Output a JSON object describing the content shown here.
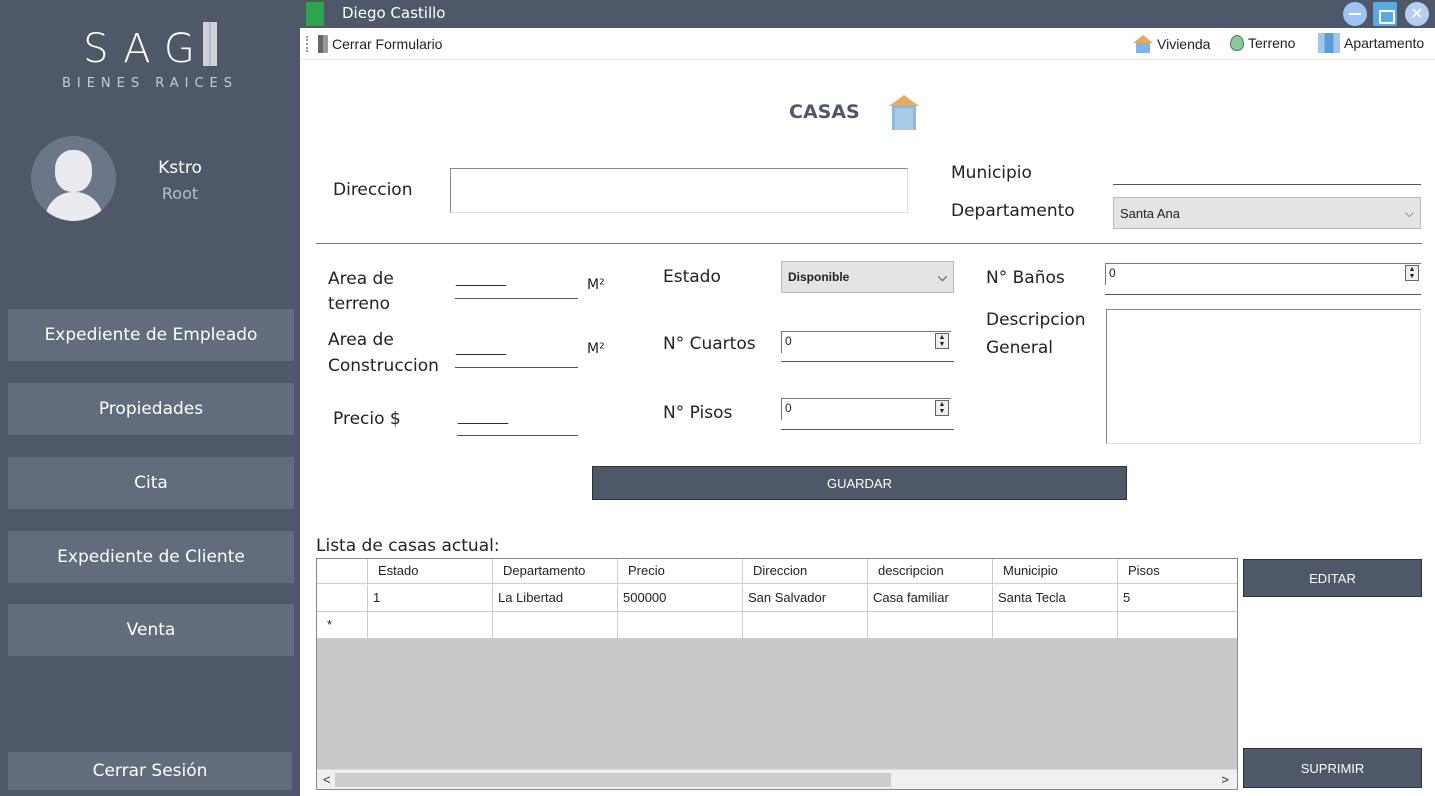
{
  "sidebar": {
    "logo": "SAG",
    "logo_sub": "BIENES RAICES",
    "user_name": "Kstro",
    "user_role": "Root",
    "nav": [
      "Expediente de Empleado",
      "Propiedades",
      "Cita",
      "Expediente de Cliente",
      "Venta"
    ],
    "logout": "Cerrar Sesión"
  },
  "titlebar": {
    "title": "Diego Castillo",
    "close_glyph": "✕"
  },
  "toolbar": {
    "close_form": "Cerrar Formulario",
    "vivienda": "Vivienda",
    "terreno": "Terreno",
    "apartamento": "Apartamento"
  },
  "form": {
    "heading": "CASAS",
    "direccion_label": "Direccion",
    "direccion_value": "",
    "municipio_label": "Municipio",
    "departamento_label": "Departamento",
    "departamento_value": "Santa Ana",
    "area_terreno_label_1": "Area de",
    "area_terreno_label_2": "terreno",
    "area_construccion_label_1": "Area de",
    "area_construccion_label_2": "Construccion",
    "unit_m2": "M²",
    "precio_label": "Precio $",
    "blank_line": "______",
    "estado_label": "Estado",
    "estado_value": "Disponible",
    "cuartos_label": "N° Cuartos",
    "cuartos_value": "0",
    "pisos_label": "N° Pisos",
    "pisos_value": "0",
    "banos_label": "N° Baños",
    "banos_value": "0",
    "descripcion_label_1": "Descripcion",
    "descripcion_label_2": "General",
    "guardar": "GUARDAR",
    "chevron": "⌵",
    "spin_up": "▲",
    "spin_down": "▼"
  },
  "list": {
    "title": "Lista de casas actual:",
    "columns": [
      "Estado",
      "Departamento",
      "Precio",
      "Direccion",
      "descripcion",
      "Municipio",
      "Pisos"
    ],
    "rows": [
      [
        "1",
        "La Libertad",
        "500000",
        "San Salvador",
        "Casa familiar",
        "Santa Tecla",
        "5"
      ]
    ],
    "new_row_marker": "*",
    "scroll_left": "<",
    "scroll_right": ">",
    "editar": "EDITAR",
    "suprimir": "SUPRIMIR"
  }
}
